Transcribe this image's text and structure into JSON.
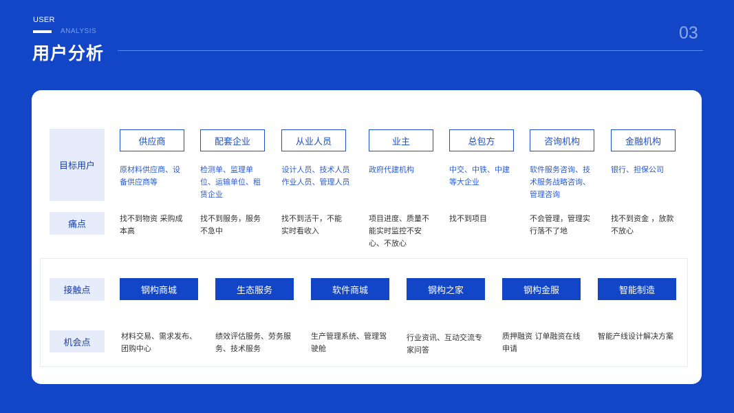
{
  "header": {
    "label_en_1": "USER",
    "label_en_2": "ANALYSIS",
    "title": "用户分析",
    "page_number": "03"
  },
  "rows": {
    "target": "目标用户",
    "pain": "痛点",
    "touchpoint": "接触点",
    "opportunity": "机会点"
  },
  "segments": [
    {
      "name": "供应商",
      "desc": "原材料供应商、设备供应商等",
      "pain": "找不到物资   采购成本高"
    },
    {
      "name": "配套企业",
      "desc": "检测单、监理单位、运输单位、租赁企业",
      "pain": "找不到服务，服务不急中"
    },
    {
      "name": "从业人员",
      "desc": "设计人员、技术人员作业人员、管理人员",
      "pain": "找不到活干，不能实时看收入"
    },
    {
      "name": "业主",
      "desc": "政府代建机构",
      "pain": "项目进度、质量不能实时监控不安心、不放心"
    },
    {
      "name": "总包方",
      "desc": "中交、中铁、中建等大企业",
      "pain": "找不到项目"
    },
    {
      "name": "咨询机构",
      "desc": "软件服务咨询、技术服务战略咨询、管理咨询",
      "pain": "不会管理，管理实行落不了地"
    },
    {
      "name": "金融机构",
      "desc": "银行、担保公司",
      "pain": "找不到资金 ，放款不放心"
    }
  ],
  "touchpoints": [
    {
      "name": "钢构商城",
      "opportunity": "材料交易、需求发布、团购中心"
    },
    {
      "name": "生态服务",
      "opportunity": "绩效评估服务、劳务服务、技术服务"
    },
    {
      "name": "软件商城",
      "opportunity": "生产管理系统、管理驾驶舱"
    },
    {
      "name": "钢构之家",
      "opportunity": "行业资讯、互动交流专家问答"
    },
    {
      "name": "钢构金服",
      "opportunity": "质押融资 订单融资在线申请"
    },
    {
      "name": "智能制造",
      "opportunity": "智能产线设计解决方案"
    }
  ]
}
